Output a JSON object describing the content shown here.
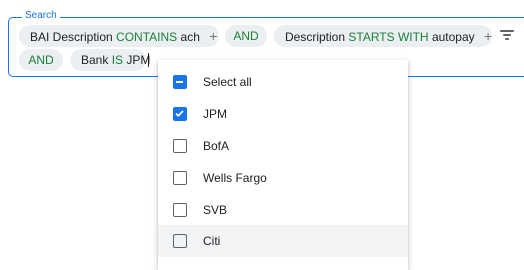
{
  "search": {
    "legend": "Search",
    "chips": [
      {
        "field": "BAI Description",
        "op": "CONTAINS",
        "value": "ach",
        "plus": "+"
      },
      {
        "connector": "AND"
      },
      {
        "field": "Description",
        "op": "STARTS WITH",
        "value": "autopay",
        "plus": "+"
      },
      {
        "connector": "AND"
      },
      {
        "field": "Bank",
        "op": "IS",
        "value": "JPM"
      }
    ],
    "filter_icon": "filter-icon"
  },
  "dropdown": {
    "options": [
      {
        "label": "Select all",
        "state": "indeterminate"
      },
      {
        "label": "JPM",
        "state": "checked"
      },
      {
        "label": "BofA",
        "state": "unchecked"
      },
      {
        "label": "Wells Fargo",
        "state": "unchecked"
      },
      {
        "label": "SVB",
        "state": "unchecked"
      },
      {
        "label": "Citi",
        "state": "unchecked"
      }
    ],
    "hovered_option": "Citi"
  },
  "colors": {
    "accent": "#1a73e8",
    "operator": "#188038",
    "chip_bg": "#eceff1"
  }
}
